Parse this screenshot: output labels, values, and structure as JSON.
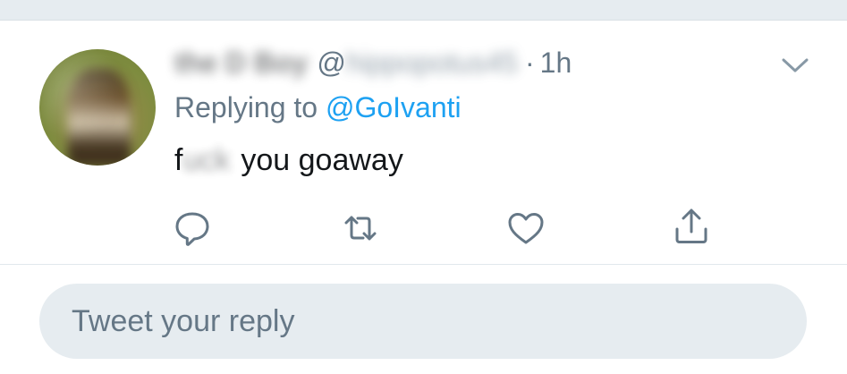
{
  "tweet": {
    "author": {
      "display_name": "the D Boy",
      "handle_at": "@",
      "handle_rest": "hippopotus45"
    },
    "separator": "·",
    "time": "1h",
    "replying_prefix": "Replying to ",
    "replying_mention": "@GoIvanti",
    "text": {
      "first_char": "f",
      "censored": "uck",
      "rest": "you goaway"
    }
  },
  "icons": {
    "menu": "chevron-down-icon",
    "reply": "reply-icon",
    "retweet": "retweet-icon",
    "like": "heart-icon",
    "share": "share-icon"
  },
  "composer": {
    "placeholder": "Tweet your reply"
  },
  "colors": {
    "accent": "#1da1f2",
    "secondary_text": "#657786",
    "primary_text": "#14171a",
    "band": "#e6ecf0"
  }
}
